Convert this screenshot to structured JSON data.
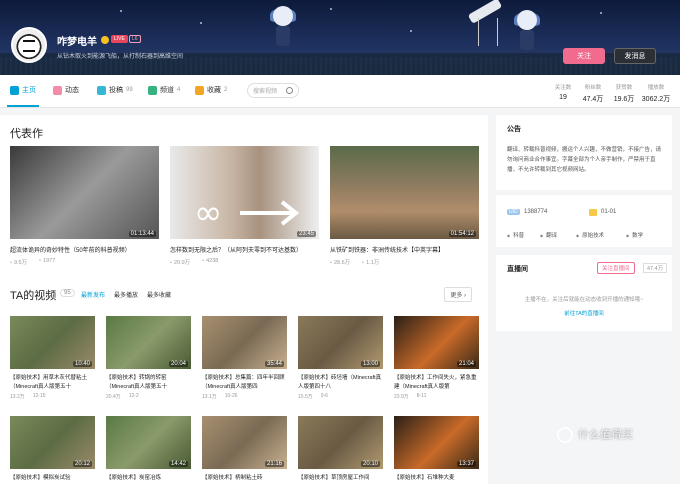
{
  "profile": {
    "name": "咋梦电羊",
    "live_badge": "LIVE",
    "level_badge": "L6",
    "sign": "从钻木取火到能源飞船，从打制石器到高维空间",
    "follow_label": "关注",
    "message_label": "发消息"
  },
  "nav": {
    "items": [
      {
        "label": "主页",
        "count": "",
        "color": "#00a1d6"
      },
      {
        "label": "动态",
        "count": "",
        "color": "#f48ba8"
      },
      {
        "label": "投稿",
        "count": "99",
        "color": "#34b8d6"
      },
      {
        "label": "频道",
        "count": "4",
        "color": "#36b37e"
      },
      {
        "label": "收藏",
        "count": "2",
        "color": "#f5a524"
      }
    ],
    "search_placeholder": "搜索视频"
  },
  "stats": [
    {
      "label": "关注数",
      "value": "19"
    },
    {
      "label": "粉丝数",
      "value": "47.4万"
    },
    {
      "label": "获赞数",
      "value": "19.6万"
    },
    {
      "label": "播放数",
      "value": "3062.2万"
    }
  ],
  "representative": {
    "title": "代表作",
    "items": [
      {
        "title": "超流体诡异的奇妙特性（50年前的科普视频）",
        "duration": "01:13:44",
        "plays": "9.5万",
        "danmaku": "1977"
      },
      {
        "title": "怎样数到无限之后？（从阿列夫零到不可达基数）",
        "duration": "23:45",
        "plays": "20.9万",
        "danmaku": "4238"
      },
      {
        "title": "从铁矿到铁器：非洲传统技术【中英字幕】",
        "duration": "01:54:12",
        "plays": "28.6万",
        "danmaku": "1.1万"
      }
    ]
  },
  "videos": {
    "title": "TA的视频",
    "count": "95",
    "tabs": [
      "最新发布",
      "最多播放",
      "最多收藏"
    ],
    "more_label": "更多",
    "items": [
      {
        "title": "【原始技术】用草木灰代替粘土（Minecraft真人版第五十",
        "duration": "10:40",
        "plays": "13.2万",
        "date": "12-15"
      },
      {
        "title": "【原始技术】转锅的转窑（Minecraft真人版第五十",
        "duration": "20:04",
        "plays": "20.4万",
        "date": "12-2"
      },
      {
        "title": "【原始技术】总集篇：四年半回顾（Minecraft真人版第四",
        "duration": "35:44",
        "plays": "13.1万",
        "date": "10-26"
      },
      {
        "title": "【原始技术】砖坯墙（Minecraft真人版第四十八",
        "duration": "13:00",
        "plays": "15.5万",
        "date": "9-6"
      },
      {
        "title": "【原始技术】工作间失火，紧急重建（Minecraft真人版第",
        "duration": "21:04",
        "plays": "23.9万",
        "date": "8-11"
      },
      {
        "title": "【原始技术】模拟炭试验",
        "duration": "20:12",
        "plays": "",
        "date": ""
      },
      {
        "title": "【原始技术】炭窑冶炼",
        "duration": "14:42",
        "plays": "",
        "date": ""
      },
      {
        "title": "【原始技术】柄制粘土砖",
        "duration": "21:16",
        "plays": "",
        "date": ""
      },
      {
        "title": "【原始技术】草顶房屋工作间",
        "duration": "20:10",
        "plays": "",
        "date": ""
      },
      {
        "title": "【原始技术】石堆种大麦",
        "duration": "13:37",
        "plays": "",
        "date": ""
      }
    ]
  },
  "notice": {
    "title": "公告",
    "body": "翻译、转载科普视频，搬运个人兴趣，不做营销，不接广告，请勿询问商业合作事宜。字幕全部为个人亲手制作，严禁用于直播，不允许转载到其它视频网站。"
  },
  "info": {
    "uid_label": "UID",
    "uid": "1388774",
    "birthday": "01-01",
    "tags": [
      "科普",
      "翻译",
      "原始技术",
      "数学"
    ]
  },
  "live": {
    "title": "直播间",
    "follow_label": "关注直播间",
    "follow_count": "47.4万",
    "message": "主播不在，关注后就能在动态收到开播的通知哦~",
    "link": "前往TA的直播间"
  },
  "watermark": "什么值得买"
}
